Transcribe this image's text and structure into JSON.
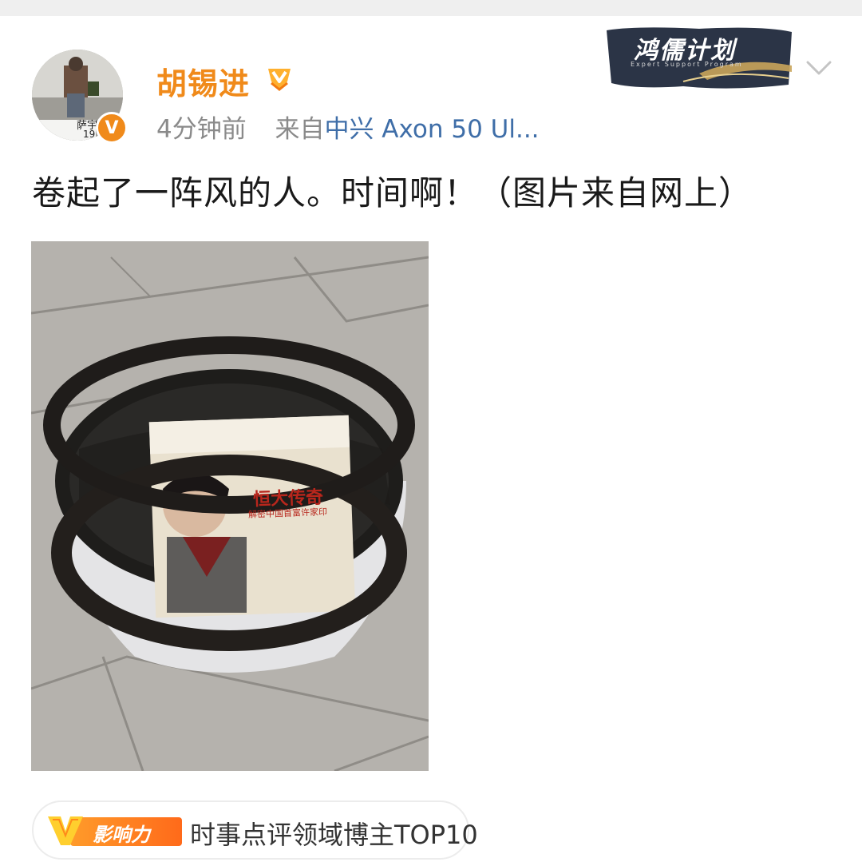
{
  "post": {
    "author": {
      "name": "胡锡进",
      "avatar_text": "萨宇",
      "avatar_year": "19",
      "verified_mark": "V"
    },
    "time": "4分钟前",
    "source_prefix": "来自",
    "source_device": "中兴 Axon 50 Ul...",
    "text": "卷起了一阵风的人。时间啊！（图片来自网上）",
    "image": {
      "book_title": "恒大传奇",
      "book_subtitle": "解密中国首富许家印"
    }
  },
  "sponsor": {
    "title": "鸿儒计划",
    "subtitle": "Expert Support Program"
  },
  "influence": {
    "badge_label": "影响力",
    "text": "时事点评领域博主TOP10"
  },
  "colors": {
    "brand_orange": "#f08a1a",
    "source_blue": "#3f6ea8",
    "meta_gray": "#8a8a8a"
  },
  "icons": [
    "level-badge-icon",
    "chevron-down-icon",
    "verified-icon"
  ]
}
